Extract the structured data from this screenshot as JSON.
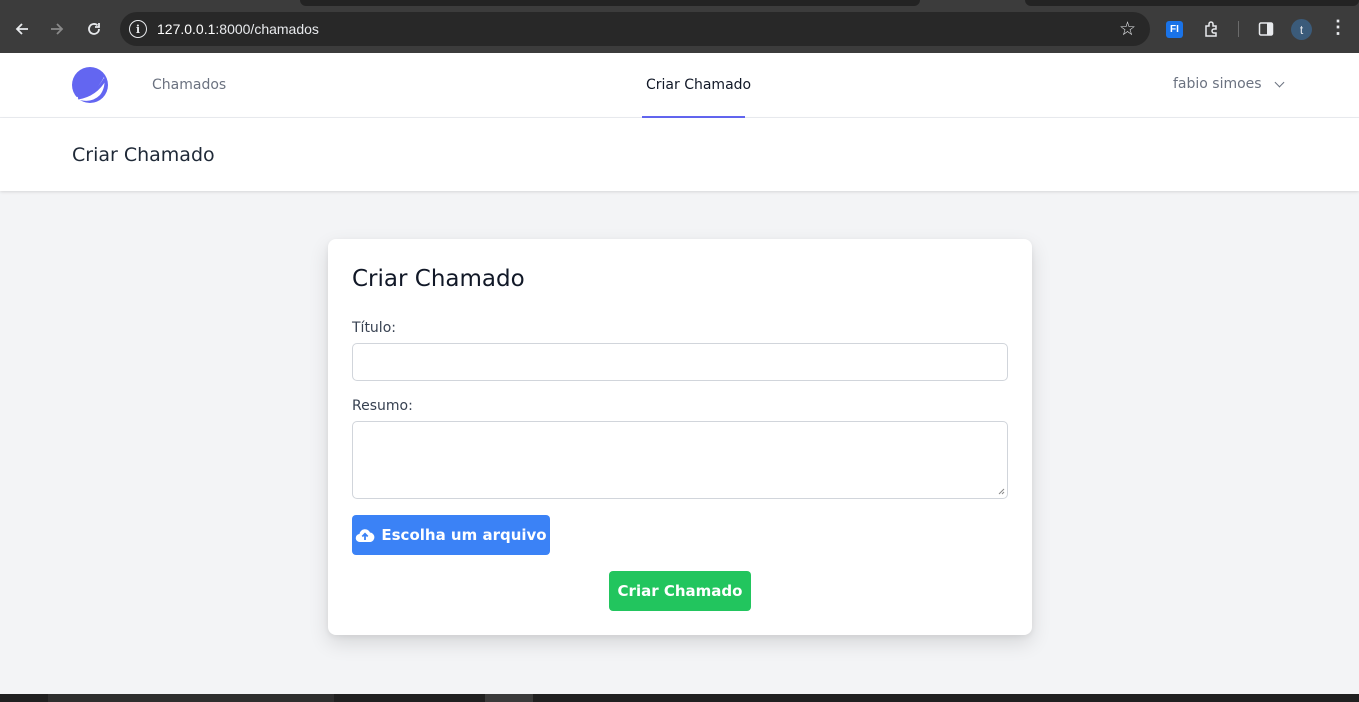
{
  "browser": {
    "url_host": "127.0.0.1",
    "url_rest": ":8000/chamados",
    "profile_initial": "t",
    "extension_label": "FI"
  },
  "nav": {
    "links": [
      {
        "label": "Chamados",
        "active": false
      },
      {
        "label": "Criar Chamado",
        "active": true
      }
    ],
    "user_name": "fabio simoes",
    "accent_color": "#6366f1"
  },
  "header": {
    "title": "Criar Chamado"
  },
  "form": {
    "title": "Criar Chamado",
    "titulo_label": "Título:",
    "titulo_value": "",
    "resumo_label": "Resumo:",
    "resumo_value": "",
    "upload_label": "Escolha um arquivo",
    "upload_icon": "cloud-upload-icon",
    "submit_label": "Criar Chamado",
    "upload_color": "#3b82f6",
    "submit_color": "#22c55e"
  }
}
